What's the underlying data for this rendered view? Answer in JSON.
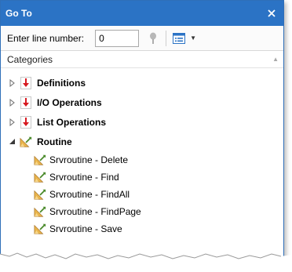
{
  "window": {
    "title": "Go To"
  },
  "toolbar": {
    "line_label": "Enter line number:",
    "line_value": "0"
  },
  "categories": {
    "header": "Categories",
    "groups": [
      {
        "label": "Definitions",
        "expanded": false,
        "icon": "red-down-arrow-icon"
      },
      {
        "label": "I/O Operations",
        "expanded": false,
        "icon": "red-down-arrow-icon"
      },
      {
        "label": "List Operations",
        "expanded": false,
        "icon": "red-down-arrow-icon"
      },
      {
        "label": "Routine",
        "expanded": true,
        "icon": "routine-icon",
        "children": [
          "Srvroutine - Delete",
          "Srvroutine - Find",
          "Srvroutine - FindAll",
          "Srvroutine - FindPage",
          "Srvroutine - Save"
        ]
      }
    ]
  },
  "colors": {
    "titlebar": "#2b73c5",
    "accent_red": "#d71920"
  }
}
